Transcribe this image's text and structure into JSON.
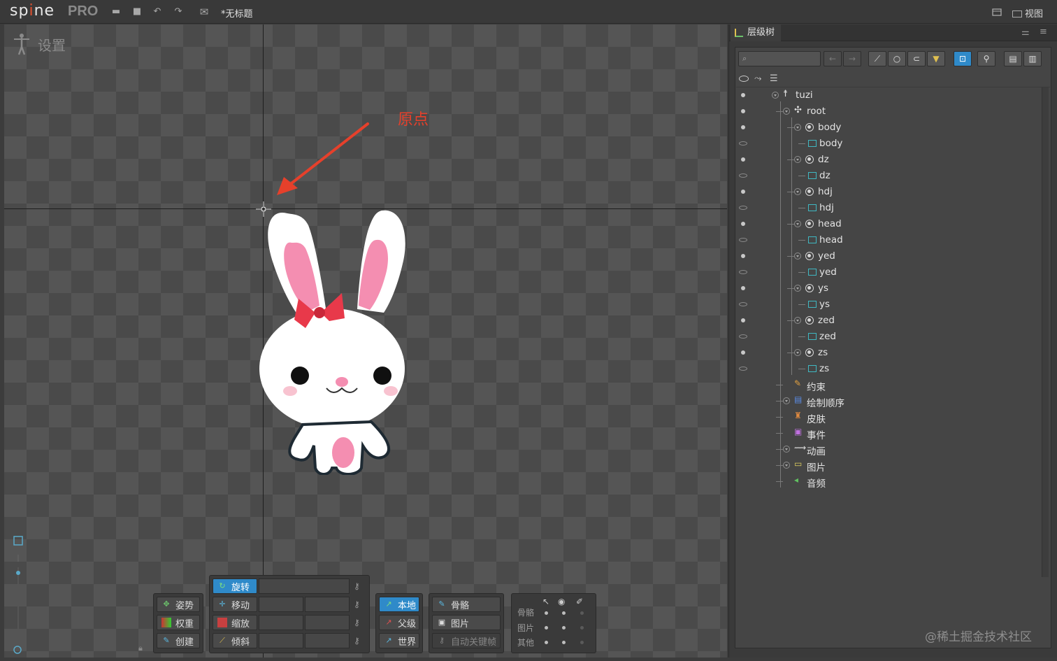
{
  "app": {
    "logo_text": "spine",
    "edition": "PRO",
    "document_title": "*无标题",
    "view_menu": "视图"
  },
  "viewport": {
    "mode_label": "设置",
    "origin_annotation": "原点",
    "annotation_color": "#e6402b"
  },
  "toolbar": {
    "modes": [
      {
        "label": "姿势",
        "icon": "pose-icon"
      },
      {
        "label": "权重",
        "icon": "weights-icon"
      },
      {
        "label": "创建",
        "icon": "create-icon"
      }
    ],
    "transform": [
      {
        "label": "旋转",
        "icon": "rotate-icon",
        "active": true
      },
      {
        "label": "移动",
        "icon": "translate-icon",
        "active": false
      },
      {
        "label": "缩放",
        "icon": "scale-icon",
        "active": false
      },
      {
        "label": "倾斜",
        "icon": "shear-icon",
        "active": false
      }
    ],
    "axes": [
      {
        "label": "本地",
        "active": true
      },
      {
        "label": "父级",
        "active": false
      },
      {
        "label": "世界",
        "active": false
      }
    ],
    "compensate": [
      {
        "label": "骨骼"
      },
      {
        "label": "图片"
      },
      {
        "label": "自动关键帧",
        "disabled": true
      }
    ],
    "options": {
      "rows": [
        "骨骼",
        "图片",
        "其他"
      ]
    }
  },
  "tree": {
    "tab_label": "层级树",
    "search_placeholder": "",
    "accent": "#2f8ac9",
    "items": [
      {
        "label": "tuzi",
        "type": "skeleton",
        "depth": 0
      },
      {
        "label": "root",
        "type": "root",
        "depth": 1
      },
      {
        "label": "body",
        "type": "bone",
        "depth": 2
      },
      {
        "label": "body",
        "type": "slot",
        "depth": 3
      },
      {
        "label": "dz",
        "type": "bone",
        "depth": 2
      },
      {
        "label": "dz",
        "type": "slot",
        "depth": 3
      },
      {
        "label": "hdj",
        "type": "bone",
        "depth": 2
      },
      {
        "label": "hdj",
        "type": "slot",
        "depth": 3
      },
      {
        "label": "head",
        "type": "bone",
        "depth": 2
      },
      {
        "label": "head",
        "type": "slot",
        "depth": 3
      },
      {
        "label": "yed",
        "type": "bone",
        "depth": 2
      },
      {
        "label": "yed",
        "type": "slot",
        "depth": 3
      },
      {
        "label": "ys",
        "type": "bone",
        "depth": 2
      },
      {
        "label": "ys",
        "type": "slot",
        "depth": 3
      },
      {
        "label": "zed",
        "type": "bone",
        "depth": 2
      },
      {
        "label": "zed",
        "type": "slot",
        "depth": 3
      },
      {
        "label": "zs",
        "type": "bone",
        "depth": 2
      },
      {
        "label": "zs",
        "type": "slot",
        "depth": 3
      },
      {
        "label": "约束",
        "type": "constraints",
        "depth": 1
      },
      {
        "label": "绘制顺序",
        "type": "draw-order",
        "depth": 1
      },
      {
        "label": "皮肤",
        "type": "skins",
        "depth": 1
      },
      {
        "label": "事件",
        "type": "events",
        "depth": 1
      },
      {
        "label": "动画",
        "type": "animations",
        "depth": 1
      },
      {
        "label": "图片",
        "type": "images",
        "depth": 1
      },
      {
        "label": "音频",
        "type": "audio",
        "depth": 1
      }
    ]
  },
  "watermark": "@稀土掘金技术社区"
}
